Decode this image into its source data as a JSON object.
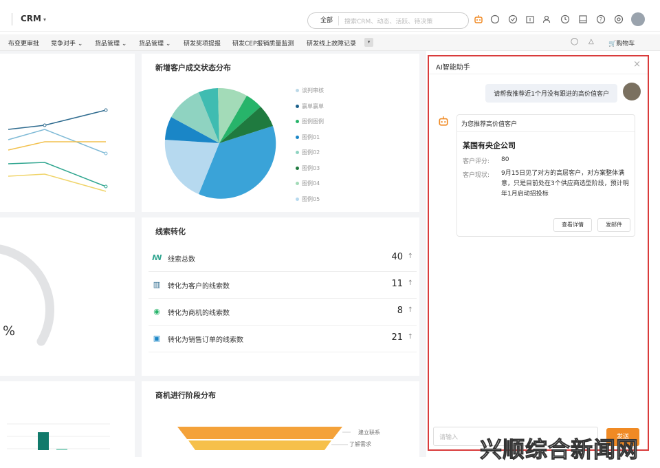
{
  "header": {
    "app_name": "CRM",
    "search_scope": "全部",
    "search_placeholder": "搜索CRM、动态、活跃、待决策",
    "icons": [
      "robot-icon",
      "chat-icon",
      "check-circle-icon",
      "calendar-icon",
      "users-icon",
      "clock-icon",
      "inbox-icon",
      "help-icon",
      "settings-icon"
    ]
  },
  "nav": {
    "items": [
      "布变更审批",
      "竞争对手",
      "货品管理",
      "货品管理",
      "研发奖项提报",
      "研发CEP报销质量监测",
      "研发线上故障记录"
    ],
    "cart_label": "购物车"
  },
  "pie_card": {
    "title": "新增客户成交状态分布",
    "legend": [
      "谈判审核",
      "赢单赢单",
      "图例图例",
      "图例01",
      "图例02",
      "图例03",
      "图例04",
      "图例05"
    ],
    "colors": [
      "#3aa3d8",
      "#b6d9ef",
      "#1a86c7",
      "#3fbcb1",
      "#8fd3c1",
      "#1f7a3f",
      "#27b46a",
      "#10a38a"
    ]
  },
  "leads_card": {
    "title": "线索转化",
    "rows": [
      {
        "label": "线索总数",
        "value": "40"
      },
      {
        "label": "转化为客户的线索数",
        "value": "11"
      },
      {
        "label": "转化为商机的线索数",
        "value": "8"
      },
      {
        "label": "转化为销售订单的线索数",
        "value": "21"
      }
    ],
    "arrow": "↑"
  },
  "gauge_card": {
    "percent_text": "%"
  },
  "funnel_card": {
    "title": "商机进行阶段分布",
    "stages": [
      "建立联系",
      "了解需求"
    ]
  },
  "assistant": {
    "title": "AI智能助手",
    "user_message": "请帮我推荐近1个月没有跟进的高价值客户",
    "bot_intro": "为您推荐高价值客户",
    "company": "某国有央企公司",
    "score_label": "客户评分:",
    "score_value": "80",
    "status_label": "客户现状:",
    "status_value": "9月15日见了对方的高层客户，对方案整体满意，只是目前处在3个供应商选型阶段，预计明年1月启动招投标",
    "btn_detail": "查看详情",
    "btn_mail": "发邮件",
    "input_placeholder": "请输入",
    "send_label": "发送"
  },
  "watermark": "兴顺综合新闻网"
}
